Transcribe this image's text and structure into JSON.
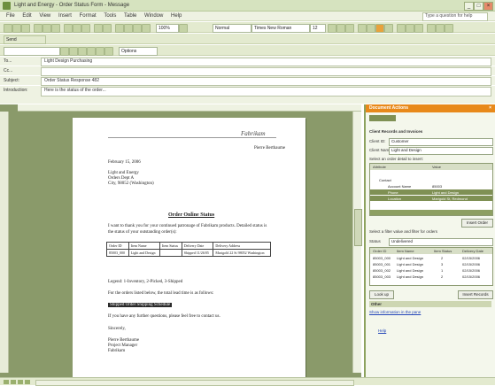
{
  "window": {
    "title": "Light and Energy - Order Status Form - Message"
  },
  "menu": [
    "File",
    "Edit",
    "View",
    "Insert",
    "Format",
    "Tools",
    "Table",
    "Window",
    "Help"
  ],
  "help_box": "Type a question for help",
  "toolbar1": {
    "style_value": "Normal",
    "font_value": "Times New Roman",
    "size_value": "12"
  },
  "toolbar2": {
    "send_label": "Send",
    "options_label": "Options"
  },
  "header": {
    "to_label": "To...",
    "to_value": "Light Design Purchasing",
    "cc_label": "Cc...",
    "cc_value": "",
    "subject_label": "Subject:",
    "subject_value": "Order Status Response 482",
    "intro_label": "Introduction:",
    "intro_value": "Here is the status of the order..."
  },
  "doc": {
    "logo": "Fabrikam",
    "from_name": "Pierre Berthaume",
    "date": "February 15, 2006",
    "addr1": "Light and Energy",
    "addr2": "Orders Dept A",
    "addr3": "City, 98052 (Washington)",
    "title": "Order Online Status",
    "p1": "I want to thank you for your continued patronage of Fabrikam products. Detailed status is",
    "p2": "the status of your outstanding order(s):",
    "table": {
      "headers": [
        "Order ID",
        "Item Name",
        "Item Status",
        "Delivery Date",
        "Delivery Address"
      ],
      "rows": [
        [
          "85003_000",
          "Light and Design",
          "",
          "Shipped 11/26/05",
          "Marigold 22 St 98052 Washington"
        ]
      ]
    },
    "p3": "Legend: 1-Inventory, 2-Picked, 3-Shipped",
    "p4": "For the orders listed below, the total lead time is as follows:",
    "highlight": "Shipped Order Shipping Schedule",
    "p5": "If you have any further questions, please feel free to contact us.",
    "sincerely": "Sincerely,",
    "sig1": "Pierre Berthaume",
    "sig2": "Project Manager",
    "sig3": "Fabrikam"
  },
  "pane": {
    "title": "Document Actions",
    "section": "Client Records and Invoices",
    "field1_label": "Client ID:",
    "field1_value": "Customer",
    "field2_label": "Client Name:",
    "field2_value": "Light and Design",
    "grid_caption": "Select an order detail to insert:",
    "grid1": {
      "headers": [
        "Attribute",
        "Value"
      ],
      "rows": [
        [
          "",
          ""
        ],
        [
          "Contact",
          ""
        ],
        [
          "Account Name",
          "85003"
        ],
        [
          "Phone",
          "Light and Design"
        ],
        [
          "Location",
          "Marigold St, Redmond"
        ]
      ]
    },
    "insert_label": "Insert Order",
    "filter_caption": "Select a filter value and filter for orders",
    "filter_label": "Status",
    "filter_value": "Undelivered",
    "grid2": {
      "headers": [
        "Order ID",
        "Item Name",
        "Item Status",
        "Delivery Date"
      ],
      "rows": [
        [
          "85003_000",
          "Light and Design",
          "2",
          "02/15/2006"
        ],
        [
          "85003_001",
          "Light and Design",
          "3",
          "02/15/2006"
        ],
        [
          "85003_002",
          "Light and Design",
          "1",
          "02/15/2006"
        ],
        [
          "85003_003",
          "Light and Design",
          "2",
          "02/15/2006"
        ]
      ]
    },
    "lookup_label": "Look up",
    "insert_records_label": "Insert Records",
    "other_label": "Other",
    "other_link": "Show information in the pane",
    "help_link": "Help"
  },
  "colors": {
    "chrome": "#d6e3bf",
    "doc_background": "#8a9a6a",
    "pane_header": "#e8891a",
    "selection": "#7f9054"
  }
}
